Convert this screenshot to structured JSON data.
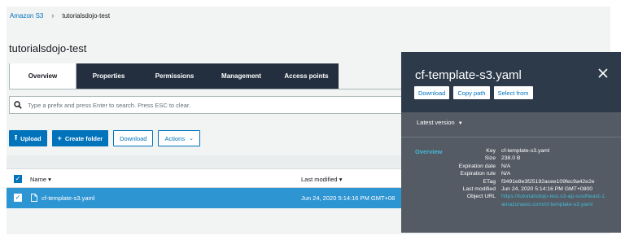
{
  "breadcrumb": {
    "root": "Amazon S3",
    "separator": "›",
    "current": "tutorialsdojo-test"
  },
  "bucket_title": "tutorialsdojo-test",
  "tabs": [
    {
      "label": "Overview",
      "active": true
    },
    {
      "label": "Properties",
      "active": false
    },
    {
      "label": "Permissions",
      "active": false
    },
    {
      "label": "Management",
      "active": false
    },
    {
      "label": "Access points",
      "active": false
    }
  ],
  "search": {
    "placeholder": "Type a prefix and press Enter to search. Press ESC to clear."
  },
  "toolbar": {
    "upload": "Upload",
    "create_folder": "Create folder",
    "download": "Download",
    "actions": "Actions"
  },
  "table": {
    "columns": {
      "name": "Name",
      "last_modified": "Last modified"
    },
    "rows": [
      {
        "name": "cf-template-s3.yaml",
        "last_modified": "Jun 24, 2020 5:14:16 PM GMT+08",
        "selected": true
      }
    ]
  },
  "panel": {
    "title": "cf-template-s3.yaml",
    "actions": {
      "download": "Download",
      "copy_path": "Copy path",
      "select_from": "Select from"
    },
    "version_label": "Latest version",
    "section": "Overview",
    "details": [
      {
        "key": "Key",
        "value": "cf-template-s3.yaml"
      },
      {
        "key": "Size",
        "value": "238.0 B"
      },
      {
        "key": "Expiration date",
        "value": "N/A"
      },
      {
        "key": "Expiration rule",
        "value": "N/A"
      },
      {
        "key": "ETag",
        "value": "f3491e8e3f25192acee109fec9a42e2e"
      },
      {
        "key": "Last modified",
        "value": "Jun 24, 2020 5:14:16 PM GMT+0800"
      },
      {
        "key": "Object URL",
        "value": "https://tutorialsdojo-test.s3-ap-southeast-1.amazonaws.com/cf-template-s3.yaml"
      }
    ]
  },
  "colors": {
    "accent": "#0073bb",
    "nav": "#232f3e",
    "selected_row": "#2e95d3",
    "panel": "#545b64",
    "link": "#44b9d6"
  }
}
